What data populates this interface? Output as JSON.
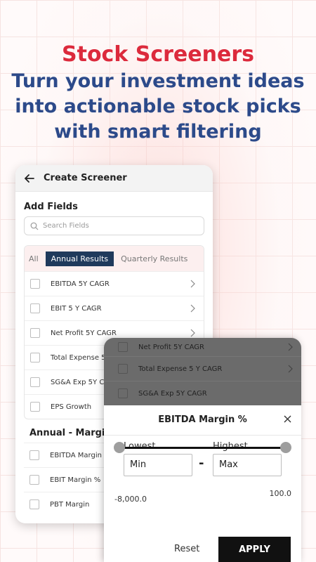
{
  "hero": {
    "title": "Stock Screeners",
    "subtitle": "Turn your investment ideas into actionable stock picks with smart filtering"
  },
  "screen": {
    "header_title": "Create Screener",
    "add_fields_label": "Add Fields",
    "search_placeholder": "Search Fields",
    "tabs": [
      "All",
      "Annual Results",
      "Quarterly Results"
    ],
    "active_tab": "Annual Results",
    "items": [
      "EBITDA 5Y CAGR",
      "EBIT 5 Y CAGR",
      "Net Profit 5Y CAGR",
      "Total Expense 5 Y CAGR",
      "SG&A Exp 5Y CAGR",
      "EPS Growth"
    ],
    "section_title": "Annual - Margins",
    "margin_items": [
      "EBITDA Margin %",
      "EBIT Margin %",
      "PBT Margin"
    ]
  },
  "overlay": {
    "dim_items": [
      "Net Profit 5Y CAGR",
      "Total Expense 5 Y CAGR",
      "SG&A Exp 5Y CAGR"
    ],
    "title": "EBITDA Margin %",
    "lowest_label": "Lowest",
    "highest_label": "Highest",
    "min_value": "Min",
    "max_value": "Max",
    "dash": "-",
    "range_min": "-8,000.0",
    "range_max": "100.0",
    "reset_label": "Reset",
    "apply_label": "APPLY"
  }
}
